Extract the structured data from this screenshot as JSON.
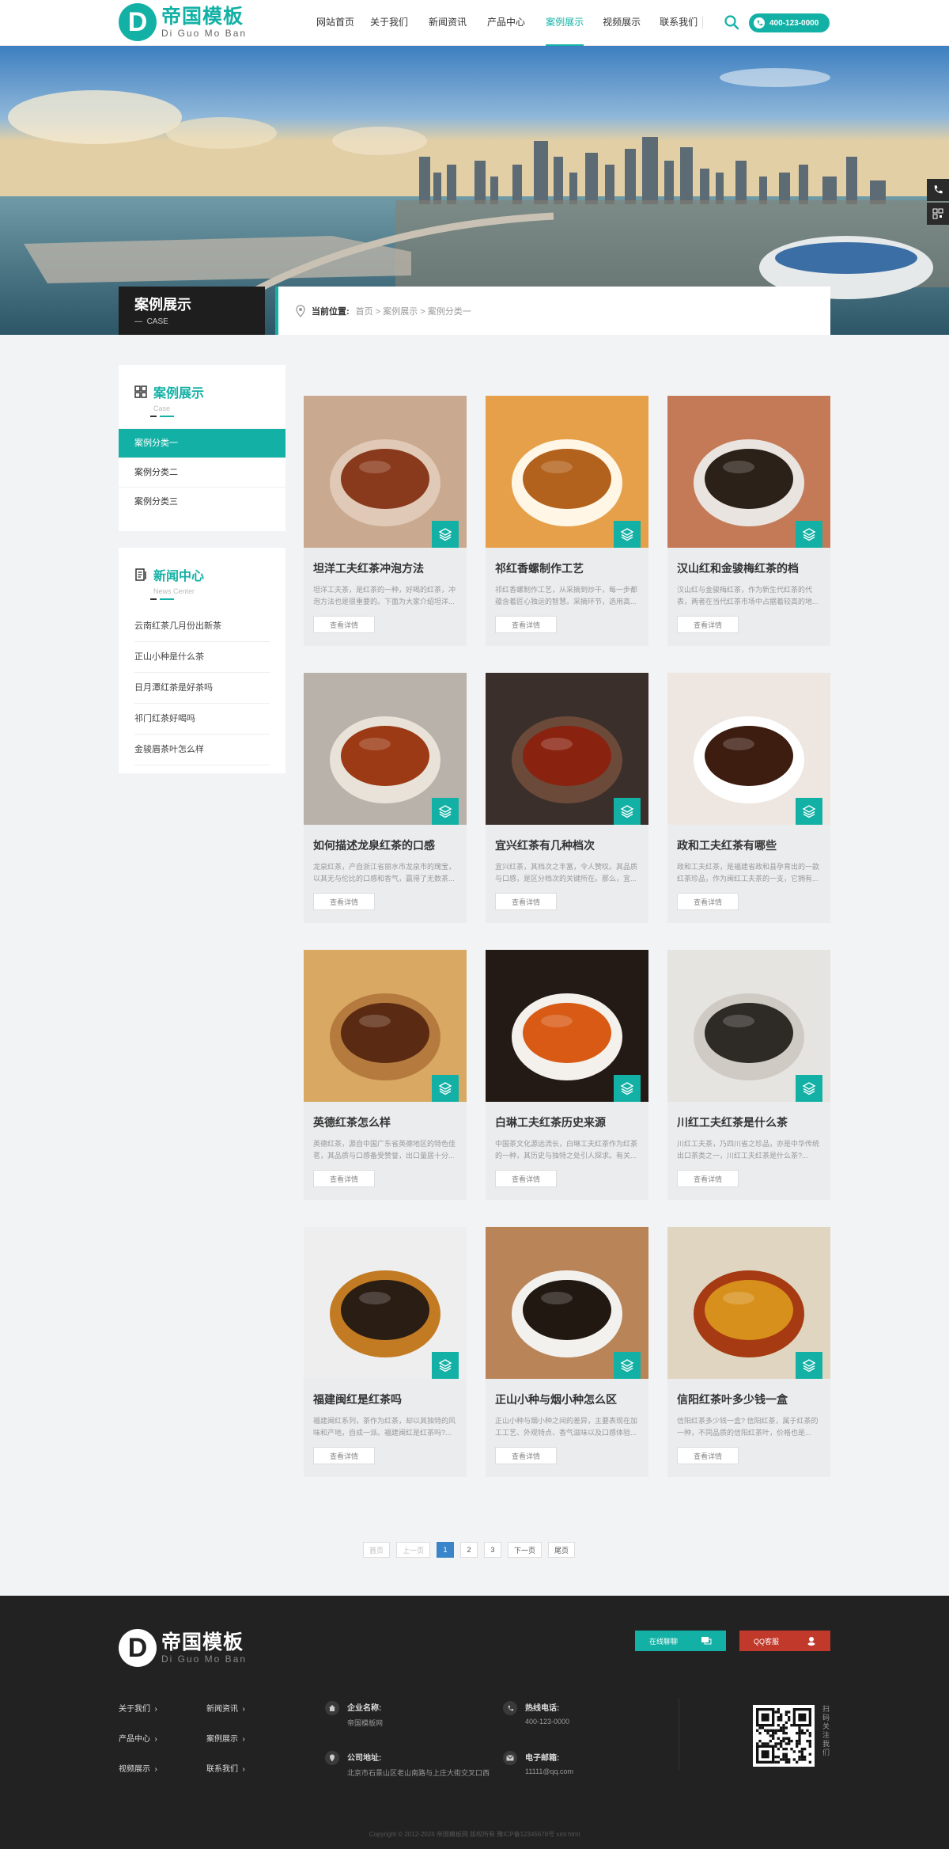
{
  "header": {
    "logo_letter": "D",
    "logo_cn": "帝国模板",
    "logo_en": "Di Guo Mo Ban",
    "nav": [
      "网站首页",
      "关于我们",
      "新闻资讯",
      "产品中心",
      "案例展示",
      "视频展示",
      "联系我们"
    ],
    "active_nav": "案例展示",
    "phone": "400-123-0000"
  },
  "banner": {
    "section_title": "案例展示",
    "section_sub": "CASE",
    "crumb_label": "当前位置:",
    "crumb_path": "首页 > 案例展示 > 案例分类一"
  },
  "sidebar": {
    "case_title": "案例展示",
    "case_sub": "Case",
    "categories": [
      "案例分类一",
      "案例分类二",
      "案例分类三"
    ],
    "news_title": "新闻中心",
    "news_sub": "News Center",
    "news": [
      "云南红茶几月份出新茶",
      "正山小种是什么茶",
      "日月潭红茶是好茶吗",
      "祁门红茶好喝吗",
      "金骏眉茶叶怎么样"
    ]
  },
  "cards": [
    {
      "title": "坦洋工夫红茶冲泡方法",
      "desc": "坦洋工夫茶，是红茶的一种，好喝的红茶，冲泡方法也是很重要的。下面为大家介绍坦洋..."
    },
    {
      "title": "祁红香螺制作工艺",
      "desc": "祁红香螺制作工艺，从采摘到炒干，每一步都蕴含着匠心独运的智慧。采摘环节，选用高..."
    },
    {
      "title": "汉山红和金骏梅红茶的档",
      "desc": "汉山红与金骏梅红茶，作为新生代红茶的代表，两者在当代红茶市场中占据着较高的地..."
    },
    {
      "title": "如何描述龙泉红茶的口感",
      "desc": "龙泉红茶，产自浙江省丽水市龙泉市的瑰宝，以其无与伦比的口感和香气，赢得了无数茶..."
    },
    {
      "title": "宜兴红茶有几种档次",
      "desc": "宜兴红茶，其档次之丰富，令人赞叹。其品质与口感，是区分档次的关键所在。那么，宜..."
    },
    {
      "title": "政和工夫红茶有哪些",
      "desc": "政和工夫红茶，是福建省政和县孕育出的一款红茶珍品，作为闽红工夫茶的一支，它拥有..."
    },
    {
      "title": "英德红茶怎么样",
      "desc": "英德红茶，源自中国广东省英德地区的特色佳茗，其品质与口感备受赞誉，出口量居十分..."
    },
    {
      "title": "白琳工夫红茶历史来源",
      "desc": "中国茶文化源远流长，白琳工夫红茶作为红茶的一种，其历史与独特之处引人探求。有关..."
    },
    {
      "title": "川红工夫红茶是什么茶",
      "desc": "川红工夫茶，乃四川省之珍品，亦是中华传统出口茶类之一，川红工夫红茶是什么茶?..."
    },
    {
      "title": "福建闽红是红茶吗",
      "desc": "福建闽红系列，茶作为红茶，却以其独特的风味和产地，自成一派。福建闽红是红茶吗?..."
    },
    {
      "title": "正山小种与烟小种怎么区",
      "desc": "正山小种与烟小种之间的差异，主要表现在加工工艺、外观特点、香气滋味以及口感体验..."
    },
    {
      "title": "信阳红茶叶多少钱一盒",
      "desc": "信阳红茶多少钱一盒? 信阳红茶，属于红茶的一种，不同品质的信阳红茶叶，价格也是..."
    }
  ],
  "card_button": "查看详情",
  "pagination": [
    "首页",
    "上一页",
    "1",
    "2",
    "3",
    "下一页",
    "尾页"
  ],
  "current_page": "1",
  "footer": {
    "logo_letter": "D",
    "logo_cn": "帝国模板",
    "logo_en": "Di Guo Mo Ban",
    "chat_btn": "在线聊聊",
    "qq_btn": "QQ客服",
    "links": [
      "关于我们",
      "新闻资讯",
      "产品中心",
      "案例展示",
      "视频展示",
      "联系我们"
    ],
    "company_label": "企业名称:",
    "company": "帝国模板网",
    "address_label": "公司地址:",
    "address": "北京市石景山区老山南路与上庄大街交叉口西",
    "phone_label": "热线电话:",
    "phone": "400-123-0000",
    "email_label": "电子邮箱:",
    "email": "11111@qq.com",
    "qr_text": "扫码关注我们",
    "copyright": "Copyright © 2012-2024 帝国模板网 版权所有 豫ICP备12345678号 xml html"
  },
  "colors": {
    "accent": "#13b1a5",
    "footer_bg": "#222222",
    "page_bg": "#f2f3f5",
    "pager_current": "#3a84c9",
    "qq_red": "#c0392b"
  }
}
